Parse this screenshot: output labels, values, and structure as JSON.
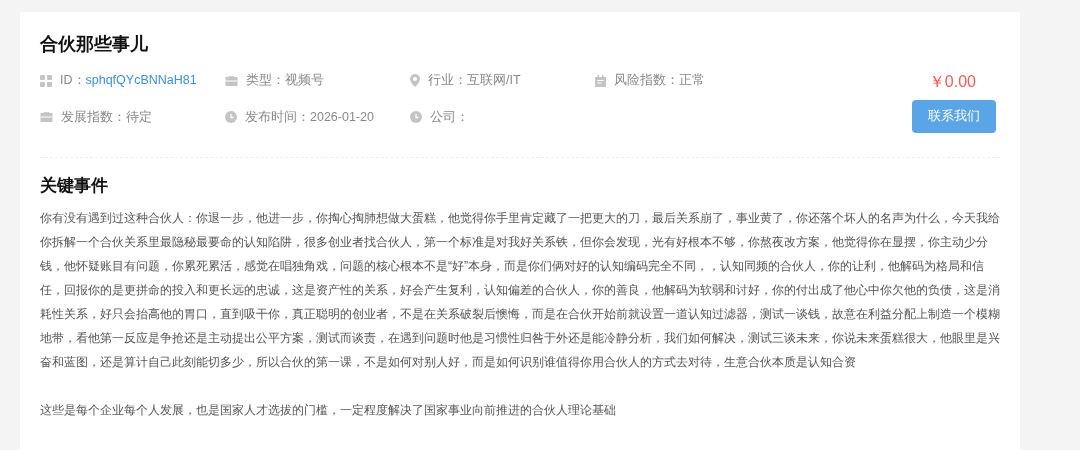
{
  "title": "合伙那些事儿",
  "meta": [
    {
      "kind": "grid",
      "label": "ID：",
      "value": "sphqfQYcBNNaH81"
    },
    {
      "kind": "briefcase",
      "label": "类型：",
      "value": "视频号"
    },
    {
      "kind": "pin",
      "label": "行业：",
      "value": "互联网/IT"
    },
    {
      "kind": "calendar",
      "label": "风险指数：",
      "value": "正常"
    },
    {
      "kind": "briefcase",
      "label": "发展指数：",
      "value": "待定"
    },
    {
      "kind": "clock",
      "label": "发布时间：",
      "value": "2026-01-20"
    },
    {
      "kind": "clock",
      "label": "公司："
    }
  ],
  "price": "￥0.00",
  "contact_button": "联系我们",
  "section_title": "关键事件",
  "paragraphs": [
    "你有没有遇到过这种合伙人：你退一步，他进一步，你掏心掏肺想做大蛋糕，他觉得你手里肯定藏了一把更大的刀，最后关系崩了，事业黄了，你还落个坏人的名声为什么，今天我给你拆解一个合伙关系里最隐秘最要命的认知陷阱，很多创业者找合伙人，第一个标准是对我好关系铁，但你会发现，光有好根本不够，你熬夜改方案，他觉得你在显摆，你主动少分钱，他怀疑账目有问题，你累死累活，感觉在唱独角戏，问题的核心根本不是“好”本身，而是你们俩对好的认知编码完全不同，，认知同频的合伙人，你的让利，他解码为格局和信任，回报你的是更拼命的投入和更长远的忠诚，这是资产性的关系，好会产生复利，认知偏差的合伙人，你的善良，他解码为软弱和讨好，你的付出成了他心中你欠他的负债，这是消耗性关系，好只会抬高他的胃口，直到吸干你，真正聪明的创业者，不是在关系破裂后懊悔，而是在合伙开始前就设置一道认知过滤器，测试一谈钱，故意在利益分配上制造一个模糊地带，看他第一反应是争抢还是主动提出公平方案，测试而谈责，在遇到问题时他是习惯性归咎于外还是能冷静分析，我们如何解决，测试三谈未来，你说未来蛋糕很大，他眼里是兴奋和蓝图，还是算计自己此刻能切多少，所以合伙的第一课，不是如何对别人好，而是如何识别谁值得你用合伙人的方式去对待，生意合伙本质是认知合资",
    "这些是每个企业每个人发展，也是国家人才选拔的门槛，一定程度解决了国家事业向前推进的合伙人理论基础"
  ]
}
